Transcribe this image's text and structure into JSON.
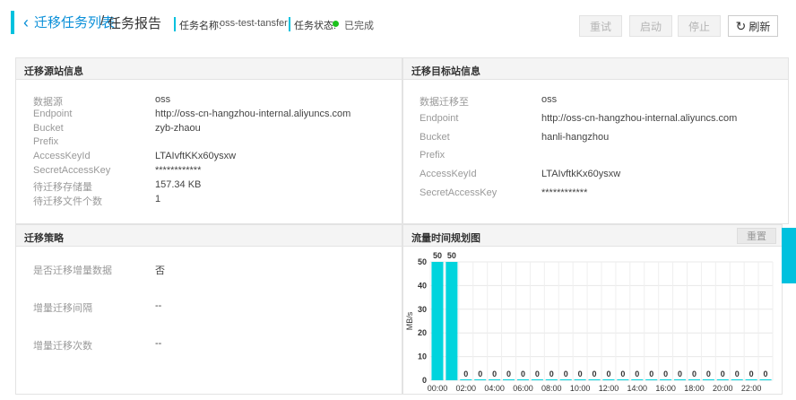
{
  "header": {
    "back_label": "迁移任务列表",
    "separator": "/",
    "current_page": "任务报告",
    "task_name_label": "任务名称:",
    "task_name_value": "oss-test-tansfer",
    "task_status_label": "任务状态:",
    "task_status_value": "已完成",
    "status_color": "#1dc11d",
    "accent_color": "#00c1de",
    "buttons": {
      "retry": "重试",
      "start": "启动",
      "stop": "停止",
      "refresh": "刷新"
    }
  },
  "source_panel": {
    "title": "迁移源站信息",
    "rows": [
      {
        "label": "数据源",
        "value": "oss"
      },
      {
        "label": "Endpoint",
        "value": "http://oss-cn-hangzhou-internal.aliyuncs.com"
      },
      {
        "label": "Bucket",
        "value": "zyb-zhaou"
      },
      {
        "label": "Prefix",
        "value": ""
      },
      {
        "label": "AccessKeyId",
        "value": "LTAIvftKKx60ysxw"
      },
      {
        "label": "SecretAccessKey",
        "value": "************"
      },
      {
        "label": "待迁移存储量",
        "value": "157.34 KB"
      },
      {
        "label": "待迁移文件个数",
        "value": "1"
      }
    ]
  },
  "target_panel": {
    "title": "迁移目标站信息",
    "rows": [
      {
        "label": "数据迁移至",
        "value": "oss"
      },
      {
        "label": "Endpoint",
        "value": "http://oss-cn-hangzhou-internal.aliyuncs.com"
      },
      {
        "label": "Bucket",
        "value": "hanli-hangzhou"
      },
      {
        "label": "Prefix",
        "value": ""
      },
      {
        "label": "AccessKeyId",
        "value": "LTAIvftkKx60ysxw"
      },
      {
        "label": "SecretAccessKey",
        "value": "************"
      }
    ]
  },
  "strategy_panel": {
    "title": "迁移策略",
    "rows": [
      {
        "label": "是否迁移增量数据",
        "value": "否"
      },
      {
        "label": "增量迁移间隔",
        "value": "--"
      },
      {
        "label": "增量迁移次数",
        "value": "--"
      }
    ]
  },
  "traffic_panel": {
    "title": "流量时间规划图",
    "reset_label": "重置"
  },
  "chart_data": {
    "type": "bar",
    "title": "流量时间规划图",
    "ylabel": "MB/s",
    "ylim": [
      0,
      50
    ],
    "yticks": [
      0,
      10,
      20,
      30,
      40,
      50
    ],
    "xtick_labels": [
      "00:00",
      "02:00",
      "04:00",
      "06:00",
      "08:00",
      "10:00",
      "12:00",
      "14:00",
      "16:00",
      "18:00",
      "20:00",
      "22:00"
    ],
    "categories": [
      "00:00",
      "01:00",
      "02:00",
      "03:00",
      "04:00",
      "05:00",
      "06:00",
      "07:00",
      "08:00",
      "09:00",
      "10:00",
      "11:00",
      "12:00",
      "13:00",
      "14:00",
      "15:00",
      "16:00",
      "17:00",
      "18:00",
      "19:00",
      "20:00",
      "21:00",
      "22:00",
      "23:00"
    ],
    "values": [
      50,
      50,
      0,
      0,
      0,
      0,
      0,
      0,
      0,
      0,
      0,
      0,
      0,
      0,
      0,
      0,
      0,
      0,
      0,
      0,
      0,
      0,
      0,
      0
    ],
    "bar_color": "#00d4dd",
    "grid": true
  }
}
